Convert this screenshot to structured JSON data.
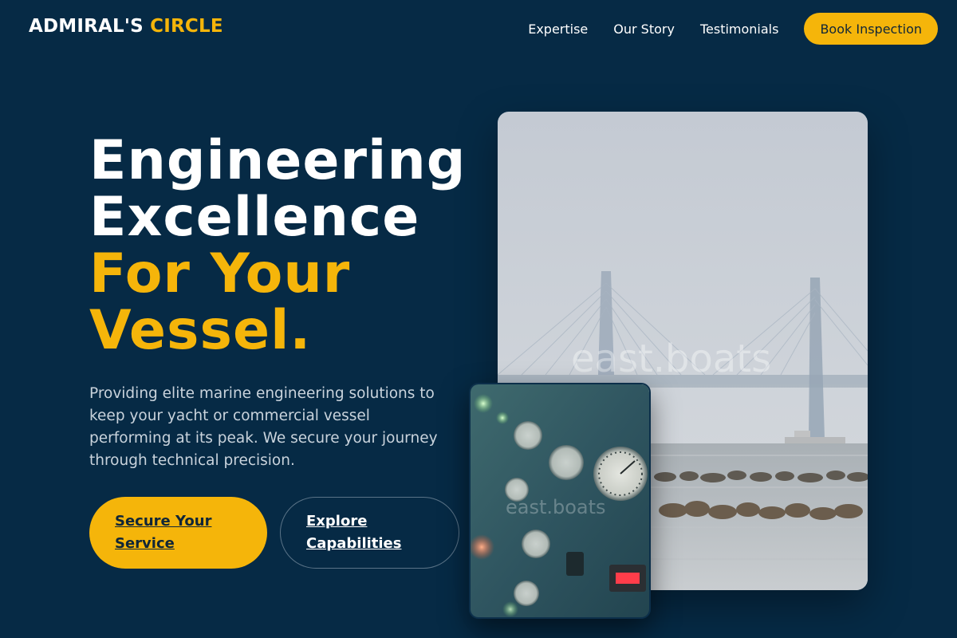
{
  "header": {
    "logo_main": "ADMIRAL'S",
    "logo_accent": "CIRCLE",
    "nav": [
      "Expertise",
      "Our Story",
      "Testimonials"
    ],
    "cta_label": "Book Inspection"
  },
  "hero": {
    "headline_lines": [
      "Engineering",
      "Excellence"
    ],
    "headline_accent_lines": [
      "For Your",
      "Vessel."
    ],
    "description": "Providing elite marine engineering solutions to keep your yacht or commercial vessel performing at its peak. We secure your journey through technical precision.",
    "primary_button": "Secure Your Service",
    "secondary_button": "Explore Capabilities"
  },
  "images": {
    "main_watermark": "east.boats",
    "small_watermark": "east.boats"
  },
  "colors": {
    "background": "#062a45",
    "accent": "#f5b50a",
    "accent_text": "#102638",
    "text_muted": "#c9d3dc"
  },
  "icons": [
    "bridge-photo",
    "gauge-panel-photo"
  ]
}
